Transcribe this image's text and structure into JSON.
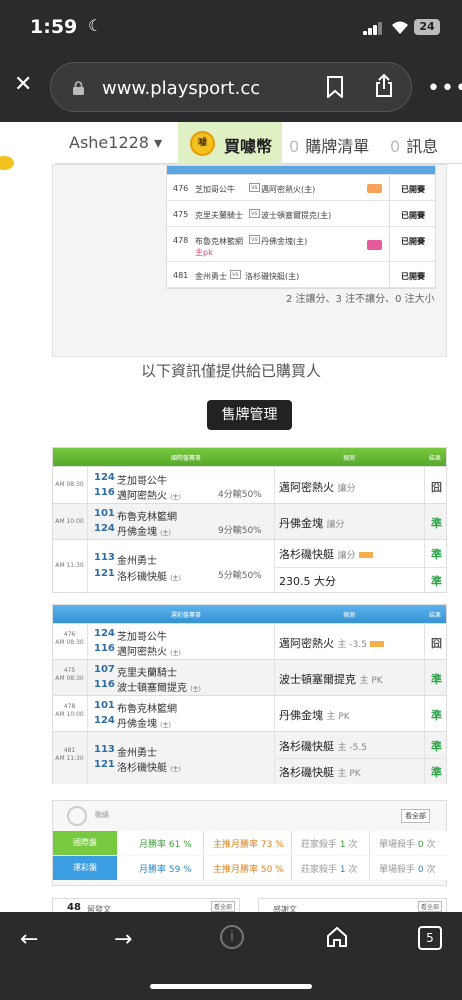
{
  "status": {
    "time": "1:59",
    "battery": "24"
  },
  "browser": {
    "url": "www.playsport.cc",
    "tab_count": "5"
  },
  "nav": {
    "user": "Ashe1228 ▾",
    "coin": "買噱幣",
    "coin_badge": "噱",
    "cart_count": "0",
    "cart": "購牌清單",
    "msg_count": "0",
    "msg": "訊息"
  },
  "mini_table": {
    "rows": [
      {
        "no": "476",
        "t1": "芝加哥公牛",
        "t2": "邁阿密熱火(主)",
        "status": "已開賽"
      },
      {
        "no": "475",
        "t1": "克里夫蘭騎士",
        "t2": "波士頓塞爾提克(主)",
        "status": "已開賽"
      },
      {
        "no": "478",
        "t1": "布魯克林籃網",
        "t2": "丹佛金塊(主)",
        "sub": "主pk",
        "status": "已開賽"
      },
      {
        "no": "481",
        "t1": "金州勇士",
        "t2": "洛杉磯快艇(主)",
        "status": "已開賽"
      }
    ],
    "vs": "vs",
    "summary": "2 注讓分、3 注不讓分、0 注大小"
  },
  "info_text": "以下資訊僅提供給已購買人",
  "sell_button": "售牌管理",
  "intl": {
    "header": {
      "c1": "國際盤賽事",
      "c2": "預測",
      "c3": "結果"
    },
    "home_mark": "(主)",
    "rows": [
      {
        "time": "AM 08:30",
        "n1": "124",
        "t1": "芝加哥公牛",
        "n2": "116",
        "t2": "邁阿密熱火",
        "odds": "4分輸50%",
        "pred": "邁阿密熱火",
        "pred_type": "讓分",
        "res": "囧"
      },
      {
        "time": "AM 10:00",
        "n1": "101",
        "t1": "布魯克林籃網",
        "n2": "124",
        "t2": "丹佛金塊",
        "odds": "9分輸50%",
        "pred": "丹佛金塊",
        "pred_type": "讓分",
        "res": "準"
      },
      {
        "time": "AM 11:30",
        "n1": "113",
        "t1": "金州勇士",
        "n2": "121",
        "t2": "洛杉磯快艇",
        "odds": "5分輸50%",
        "pred": "洛杉磯快艇",
        "pred_type": "讓分",
        "pred2": "230.5 大分",
        "res": "準",
        "res2": "準"
      }
    ]
  },
  "lottery": {
    "header": {
      "c1": "運彩盤賽事",
      "c2": "預測",
      "c3": "結果"
    },
    "rows": [
      {
        "no": "476",
        "time": "AM 08:30",
        "n1": "124",
        "t1": "芝加哥公牛",
        "n2": "116",
        "t2": "邁阿密熱火",
        "pred": "邁阿密熱火",
        "pred_type": "主 -3.5",
        "res": "囧"
      },
      {
        "no": "475",
        "time": "AM 08:30",
        "n1": "107",
        "t1": "克里夫蘭騎士",
        "n2": "116",
        "t2": "波士頓塞爾提克",
        "pred": "波士頓塞爾提克",
        "pred_type": "主 PK",
        "res": "準"
      },
      {
        "no": "478",
        "time": "AM 10:00",
        "n1": "101",
        "t1": "布魯克林籃網",
        "n2": "124",
        "t2": "丹佛金塊",
        "pred": "丹佛金塊",
        "pred_type": "主 PK",
        "res": "準"
      },
      {
        "no": "481",
        "time": "AM 11:30",
        "n1": "113",
        "t1": "金州勇士",
        "n2": "121",
        "t2": "洛杉磯快艇",
        "pred": "洛杉磯快艇",
        "pred_type": "主 -5.5",
        "pred2": "洛杉磯快艇",
        "pred2_type": "主 PK",
        "res": "準",
        "res2": "準"
      }
    ]
  },
  "stats": {
    "title": "戰績",
    "all": "看全部",
    "intl": {
      "tab": "國際盤",
      "win_label": "月勝率",
      "win": "61 %",
      "main_label": "主推月勝率",
      "main": "73 %",
      "kill_label": "莊家殺手",
      "kill": "1",
      "kill_unit": "次",
      "single_label": "單場殺手",
      "single": "0",
      "single_unit": "次"
    },
    "lottery": {
      "tab": "運彩盤",
      "win_label": "月勝率",
      "win": "59 %",
      "main_label": "主推月勝率",
      "main": "50 %",
      "kill_label": "莊家殺手",
      "kill": "1",
      "kill_unit": "次",
      "single_label": "單場殺手",
      "single": "0",
      "single_unit": "次"
    }
  },
  "cards": {
    "left_num": "48",
    "left_label": "留發文",
    "left_btn": "看全部",
    "right_label": "感謝文",
    "right_btn": "看全部"
  },
  "colors": {
    "green": "#62b82e",
    "blue": "#3b9ee2",
    "win": "#2fa548"
  }
}
